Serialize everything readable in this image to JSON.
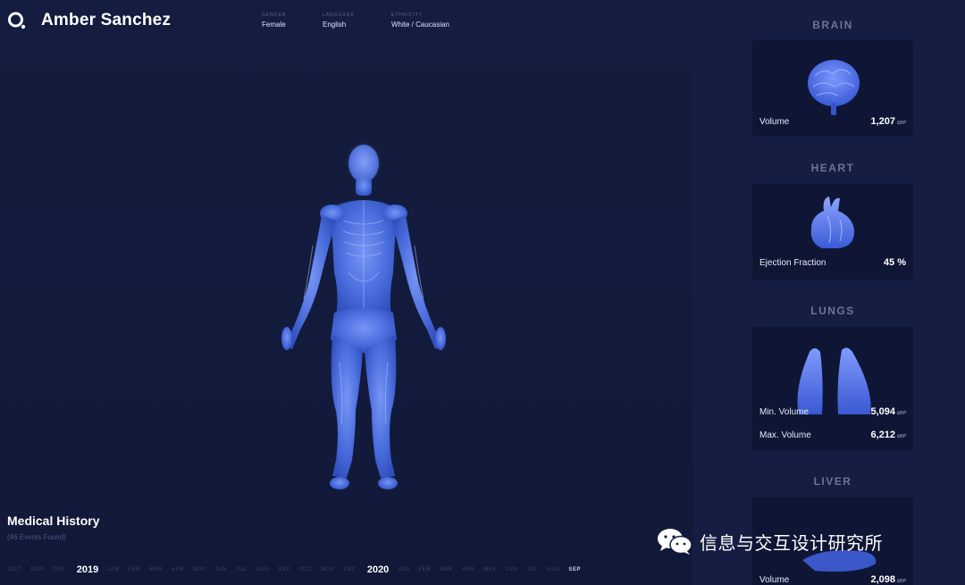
{
  "header": {
    "patient_name": "Amber Sanchez",
    "fields": [
      {
        "key": "GENDER",
        "value": "Female"
      },
      {
        "key": "LANGUAGE",
        "value": "English"
      },
      {
        "key": "ETHNICITY",
        "value": "White / Caucasian"
      }
    ]
  },
  "organs": [
    {
      "title": "BRAIN",
      "metrics": [
        {
          "label": "Volume",
          "value": "1,207",
          "unit": "cm³"
        }
      ]
    },
    {
      "title": "HEART",
      "metrics": [
        {
          "label": "Ejection Fraction",
          "value": "45 %",
          "unit": ""
        }
      ]
    },
    {
      "title": "LUNGS",
      "metrics": [
        {
          "label": "Min. Volume",
          "value": "5,094",
          "unit": "cm³"
        },
        {
          "label": "Max. Volume",
          "value": "6,212",
          "unit": "cm³"
        }
      ]
    },
    {
      "title": "LIVER",
      "metrics": [
        {
          "label": "Volume",
          "value": "2,098",
          "unit": "cm³"
        }
      ]
    }
  ],
  "history": {
    "title": "Medical History",
    "subtitle": "(46 Events Found)",
    "timeline": [
      "OCT",
      "NOV",
      "DEC",
      "2019",
      "JAN",
      "FEB",
      "MAR",
      "APR",
      "MAY",
      "JUN",
      "JUL",
      "AUG",
      "SEP",
      "OCT",
      "NOV",
      "DEC",
      "2020",
      "JAN",
      "FEB",
      "MAR",
      "APR",
      "MAY",
      "JUN",
      "JUL",
      "AUG",
      "SEP"
    ],
    "current_index": 25
  },
  "watermark": {
    "text": "信息与交互设计研究所",
    "icon": "wechat-icon"
  },
  "colors": {
    "background": "#131b3d",
    "panel": "#151e42",
    "card": "#0f1635",
    "organ_blue": "#4a6ee8",
    "muted_text": "#6b7498"
  }
}
